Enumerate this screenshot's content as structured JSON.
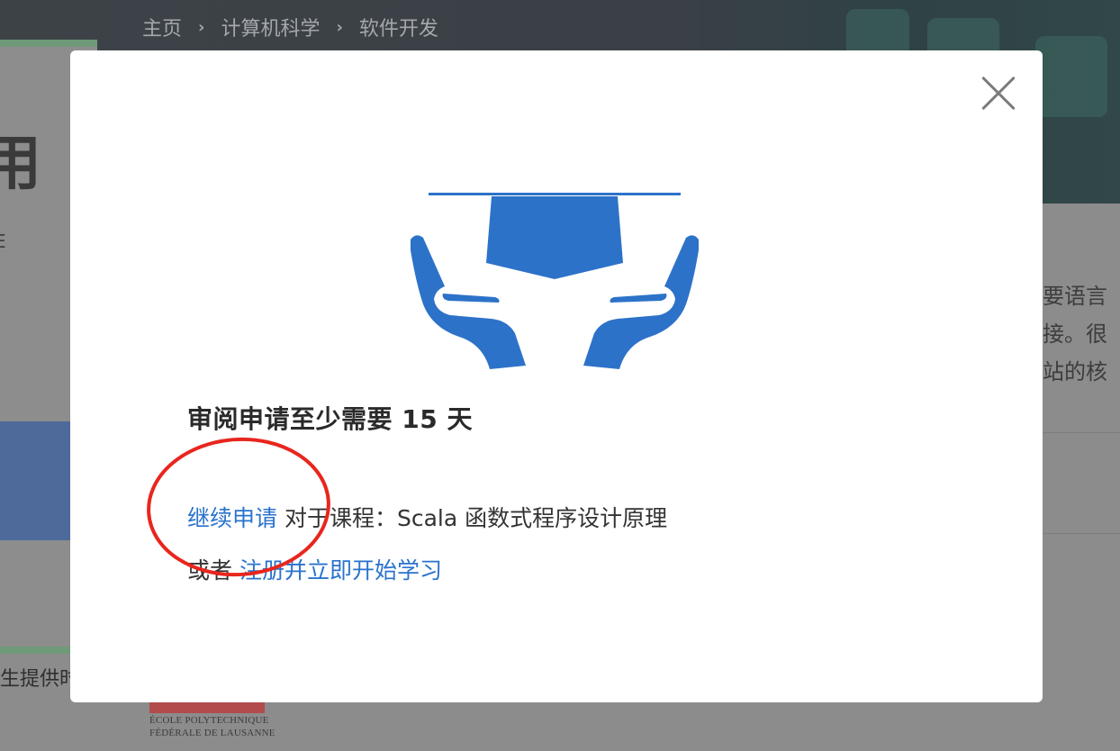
{
  "breadcrumb": {
    "items": [
      "主页",
      "计算机科学",
      "软件开发"
    ],
    "separator": "›"
  },
  "background": {
    "title_fragment": "用",
    "small_fragment": "E",
    "footer_text_fragment": "生提供时",
    "logo_lines": [
      "ÉCOLE POLYTECHNIQUE",
      "FÉDÉRALE DE LAUSANNE"
    ],
    "right_text_fragments": [
      "要语言",
      "接。很",
      "站的核"
    ]
  },
  "modal": {
    "close_icon": "close-icon",
    "illustration_icon": "graduation-cap-hands-icon",
    "heading": "审阅申请至少需要 15 天",
    "continue_link": "继续申请",
    "course_text": " 对于课程：Scala 函数式程序设计原理",
    "or_text": "或者 ",
    "enroll_link": "注册并立即开始学习"
  },
  "colors": {
    "link": "#2a73cc",
    "illustration": "#2d72c9",
    "annotation_circle": "#e8261e"
  }
}
